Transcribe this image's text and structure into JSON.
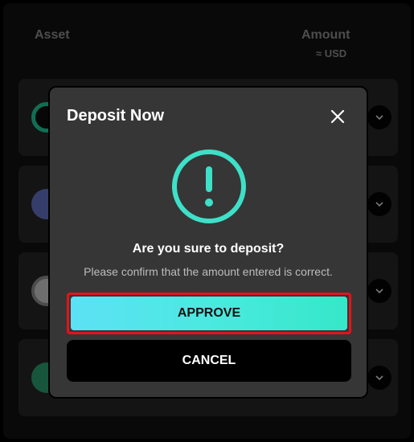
{
  "table": {
    "asset_header": "Asset",
    "amount_header": "Amount",
    "amount_sub": "≈ USD",
    "rows": [
      {
        "icon": "usdc-coin-icon"
      },
      {
        "icon": "ethereum-coin-icon"
      },
      {
        "icon": "bitcoin-coin-icon"
      },
      {
        "icon": "tether-coin-icon"
      }
    ]
  },
  "modal": {
    "title": "Deposit Now",
    "question": "Are you sure to deposit?",
    "hint": "Please confirm that the amount entered is correct.",
    "approve_label": "APPROVE",
    "cancel_label": "CANCEL"
  },
  "colors": {
    "accent": "#3ee0c8",
    "highlight_border": "#e3141b",
    "modal_bg": "#363636"
  }
}
